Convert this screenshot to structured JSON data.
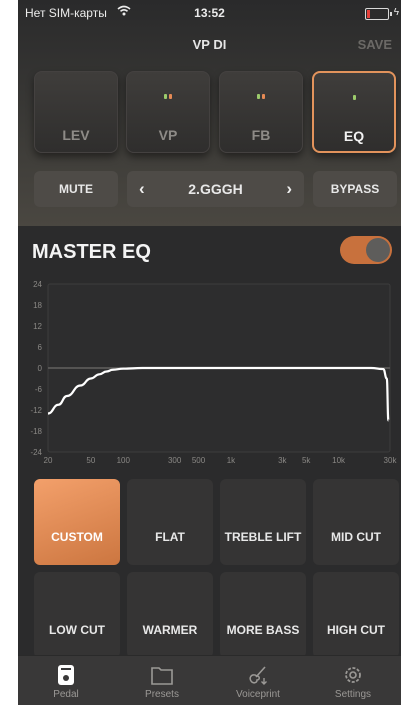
{
  "status_bar": {
    "carrier": "Нет SIM-карты",
    "time": "13:52"
  },
  "header": {
    "title": "VP DI",
    "save_label": "SAVE"
  },
  "modules": [
    {
      "label": "LEV",
      "leds": [],
      "selected": false
    },
    {
      "label": "VP",
      "leds": [
        "#9ccb6b",
        "#e68a55"
      ],
      "selected": false
    },
    {
      "label": "FB",
      "leds": [
        "#9ccb6b",
        "#e68a55"
      ],
      "selected": false
    },
    {
      "label": "EQ",
      "leds": [
        "#9ccb6b"
      ],
      "selected": true
    }
  ],
  "controls": {
    "mute_label": "MUTE",
    "preset_name": "2.GGGH",
    "bypass_label": "BYPASS",
    "prev_icon": "chevron-left-icon",
    "next_icon": "chevron-right-icon"
  },
  "master_eq": {
    "title": "MASTER EQ",
    "enabled": true,
    "accent_color": "#c8713d",
    "y_ticks": [
      "24",
      "18",
      "12",
      "6",
      "0",
      "-6",
      "-12",
      "-18",
      "-24"
    ],
    "x_ticks": [
      "20",
      "50",
      "100",
      "300",
      "500",
      "1k",
      "3k",
      "5k",
      "10k",
      "30k"
    ],
    "curve": {
      "frequencies_hz": [
        20,
        25,
        30,
        40,
        50,
        60,
        70,
        80,
        100,
        150,
        300,
        1000,
        10000,
        20000,
        26000,
        28000,
        29000
      ],
      "gain_db": [
        -13,
        -10.5,
        -8,
        -5,
        -3,
        -1.8,
        -1,
        -0.5,
        -0.2,
        0,
        0,
        0,
        0,
        0,
        -0.3,
        -3,
        -15
      ]
    }
  },
  "presets": [
    {
      "label": "CUSTOM",
      "selected": true
    },
    {
      "label": "FLAT",
      "selected": false
    },
    {
      "label": "TREBLE LIFT",
      "selected": false
    },
    {
      "label": "MID CUT",
      "selected": false
    },
    {
      "label": "LOW CUT",
      "selected": false
    },
    {
      "label": "WARMER",
      "selected": false
    },
    {
      "label": "MORE BASS",
      "selected": false
    },
    {
      "label": "HIGH CUT",
      "selected": false
    }
  ],
  "tabs": [
    {
      "label": "Pedal",
      "icon": "pedal-icon",
      "active": true
    },
    {
      "label": "Presets",
      "icon": "folder-icon",
      "active": false
    },
    {
      "label": "Voiceprint",
      "icon": "guitar-icon",
      "active": false
    },
    {
      "label": "Settings",
      "icon": "gear-icon",
      "active": false
    }
  ]
}
